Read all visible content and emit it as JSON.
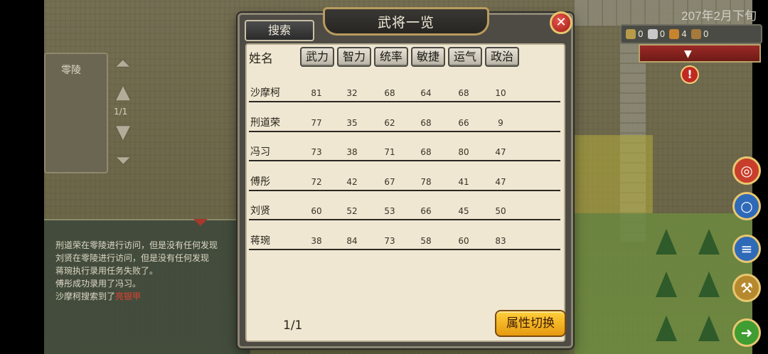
{
  "date": "207年2月下旬",
  "resources": [
    {
      "icon": "flag-icon",
      "value": "0"
    },
    {
      "icon": "soldier-icon",
      "value": "0"
    },
    {
      "icon": "horse-icon",
      "value": "4"
    },
    {
      "icon": "scroll-icon",
      "value": "0"
    }
  ],
  "left_panel": {
    "city": "零陵",
    "page": "1/1"
  },
  "log": {
    "lines": [
      {
        "text": "刑道荣在零陵进行访问，但是没有任何发现",
        "highlight": ""
      },
      {
        "text": "刘贤在零陵进行访问，但是没有任何发现",
        "highlight": ""
      },
      {
        "text": "蒋琬执行录用任务失败了。",
        "highlight": ""
      },
      {
        "text": "傅彤成功录用了冯习。",
        "highlight": ""
      },
      {
        "text": "沙摩柯搜索到了",
        "highlight": "亮银甲"
      }
    ]
  },
  "dialog": {
    "title": "武将一览",
    "search_label": "搜索",
    "name_header": "姓名",
    "columns": [
      "武力",
      "智力",
      "统率",
      "敏捷",
      "运气",
      "政治"
    ],
    "rows": [
      {
        "name": "沙摩柯",
        "values": [
          "81",
          "32",
          "68",
          "64",
          "68",
          "10"
        ]
      },
      {
        "name": "刑道荣",
        "values": [
          "77",
          "35",
          "62",
          "68",
          "66",
          "9"
        ]
      },
      {
        "name": "冯习",
        "values": [
          "73",
          "38",
          "71",
          "68",
          "80",
          "47"
        ]
      },
      {
        "name": "傅彤",
        "values": [
          "72",
          "42",
          "67",
          "78",
          "41",
          "47"
        ]
      },
      {
        "name": "刘贤",
        "values": [
          "60",
          "52",
          "53",
          "66",
          "45",
          "50"
        ]
      },
      {
        "name": "蒋琬",
        "values": [
          "38",
          "84",
          "73",
          "58",
          "60",
          "83"
        ]
      }
    ],
    "page": "1/1",
    "switch_label": "属性切换",
    "close_symbol": "✕"
  }
}
